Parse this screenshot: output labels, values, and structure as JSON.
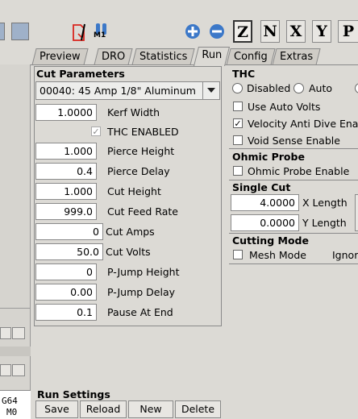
{
  "toolbar": {
    "z_label": "Z",
    "n_label": "N",
    "x_label": "X",
    "y_label": "Y",
    "p_label": "P",
    "m1_label": "M1"
  },
  "tabs": [
    "Preview",
    "DRO",
    "Statistics",
    "Run",
    "Config",
    "Extras"
  ],
  "cut_parameters": {
    "title": "Cut Parameters",
    "material": "00040: 45 Amp 1/8\" Aluminum",
    "thc_enabled_label": "THC ENABLED",
    "thc_enabled_checked": true,
    "params": [
      {
        "value": "1.0000",
        "label": "Kerf Width"
      },
      {
        "value": "1.000",
        "label": "Pierce Height"
      },
      {
        "value": "0.4",
        "label": "Pierce Delay"
      },
      {
        "value": "1.000",
        "label": "Cut Height"
      },
      {
        "value": "999.0",
        "label": "Cut Feed Rate"
      },
      {
        "value": "0",
        "label": "Cut Amps"
      },
      {
        "value": "50.0",
        "label": "Cut Volts"
      },
      {
        "value": "0",
        "label": "P-Jump Height"
      },
      {
        "value": "0.00",
        "label": "P-Jump Delay"
      },
      {
        "value": "0.1",
        "label": "Pause At End"
      }
    ]
  },
  "thc": {
    "title": "THC",
    "disabled_label": "Disabled",
    "auto_label": "Auto",
    "use_auto_volts": "Use Auto Volts",
    "velocity_anti_dive": "Velocity Anti Dive Enab",
    "void_sense": "Void Sense Enable"
  },
  "ohmic": {
    "title": "Ohmic Probe",
    "enable_label": "Ohmic Probe Enable"
  },
  "single_cut": {
    "title": "Single Cut",
    "x_value": "4.0000",
    "x_label": "X Length",
    "y_value": "0.0000",
    "y_label": "Y Length"
  },
  "cutting_mode": {
    "title": "Cutting Mode",
    "mesh_label": "Mesh Mode",
    "ignore_label": "Ignor"
  },
  "run_settings": {
    "title": "Run Settings",
    "buttons": [
      "Save",
      "Reload",
      "New",
      "Delete"
    ]
  },
  "left_status": {
    "line1": "G64",
    "line2": "M0"
  },
  "colors": {
    "background": "#dcdad5",
    "icon_red": "#d9251d",
    "icon_blue": "#3c78c8"
  }
}
